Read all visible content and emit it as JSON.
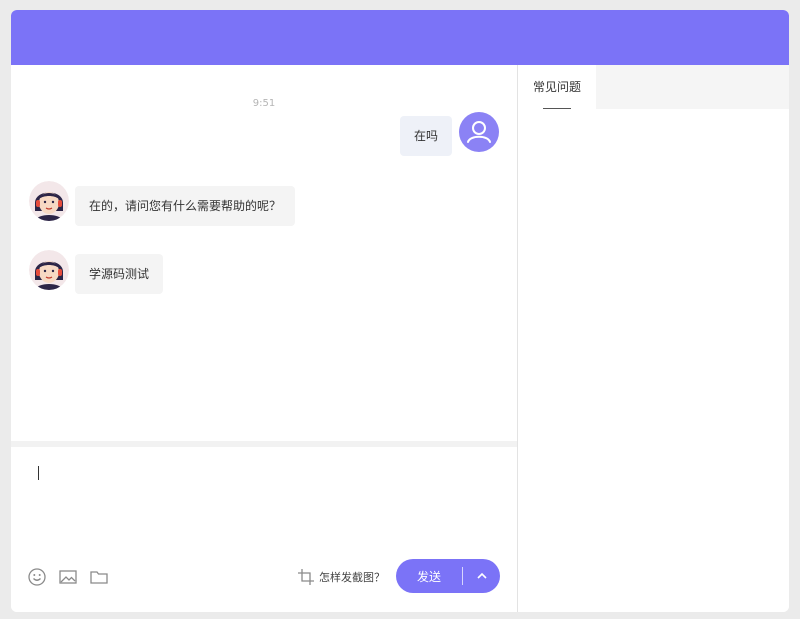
{
  "header": {
    "color": "#7b73f7"
  },
  "chat": {
    "timestamp": "9:51",
    "messages": [
      {
        "from": "user",
        "text": "在吗"
      },
      {
        "from": "agent",
        "text": "在的，请问您有什么需要帮助的呢？"
      },
      {
        "from": "agent",
        "text": "学源码测试"
      }
    ]
  },
  "composer": {
    "tools": [
      "emoji-icon",
      "image-icon",
      "folder-icon"
    ],
    "screenshot_help": "怎样发截图？",
    "send_label": "发送"
  },
  "sidebar": {
    "tabs": [
      {
        "label": "常见问题",
        "active": true
      }
    ]
  }
}
